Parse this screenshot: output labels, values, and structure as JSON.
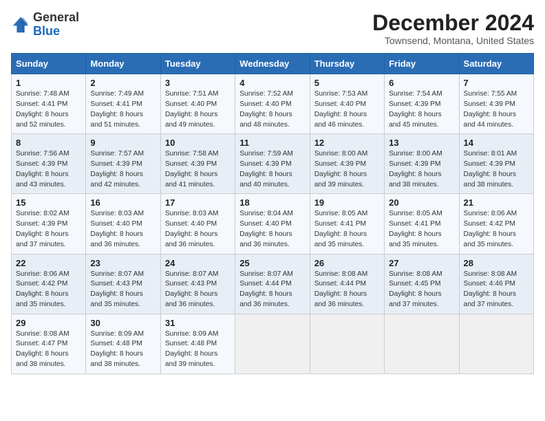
{
  "header": {
    "logo_general": "General",
    "logo_blue": "Blue",
    "title": "December 2024",
    "subtitle": "Townsend, Montana, United States"
  },
  "weekdays": [
    "Sunday",
    "Monday",
    "Tuesday",
    "Wednesday",
    "Thursday",
    "Friday",
    "Saturday"
  ],
  "weeks": [
    [
      {
        "day": "1",
        "rise": "Sunrise: 7:48 AM",
        "set": "Sunset: 4:41 PM",
        "light": "Daylight: 8 hours and 52 minutes."
      },
      {
        "day": "2",
        "rise": "Sunrise: 7:49 AM",
        "set": "Sunset: 4:41 PM",
        "light": "Daylight: 8 hours and 51 minutes."
      },
      {
        "day": "3",
        "rise": "Sunrise: 7:51 AM",
        "set": "Sunset: 4:40 PM",
        "light": "Daylight: 8 hours and 49 minutes."
      },
      {
        "day": "4",
        "rise": "Sunrise: 7:52 AM",
        "set": "Sunset: 4:40 PM",
        "light": "Daylight: 8 hours and 48 minutes."
      },
      {
        "day": "5",
        "rise": "Sunrise: 7:53 AM",
        "set": "Sunset: 4:40 PM",
        "light": "Daylight: 8 hours and 46 minutes."
      },
      {
        "day": "6",
        "rise": "Sunrise: 7:54 AM",
        "set": "Sunset: 4:39 PM",
        "light": "Daylight: 8 hours and 45 minutes."
      },
      {
        "day": "7",
        "rise": "Sunrise: 7:55 AM",
        "set": "Sunset: 4:39 PM",
        "light": "Daylight: 8 hours and 44 minutes."
      }
    ],
    [
      {
        "day": "8",
        "rise": "Sunrise: 7:56 AM",
        "set": "Sunset: 4:39 PM",
        "light": "Daylight: 8 hours and 43 minutes."
      },
      {
        "day": "9",
        "rise": "Sunrise: 7:57 AM",
        "set": "Sunset: 4:39 PM",
        "light": "Daylight: 8 hours and 42 minutes."
      },
      {
        "day": "10",
        "rise": "Sunrise: 7:58 AM",
        "set": "Sunset: 4:39 PM",
        "light": "Daylight: 8 hours and 41 minutes."
      },
      {
        "day": "11",
        "rise": "Sunrise: 7:59 AM",
        "set": "Sunset: 4:39 PM",
        "light": "Daylight: 8 hours and 40 minutes."
      },
      {
        "day": "12",
        "rise": "Sunrise: 8:00 AM",
        "set": "Sunset: 4:39 PM",
        "light": "Daylight: 8 hours and 39 minutes."
      },
      {
        "day": "13",
        "rise": "Sunrise: 8:00 AM",
        "set": "Sunset: 4:39 PM",
        "light": "Daylight: 8 hours and 38 minutes."
      },
      {
        "day": "14",
        "rise": "Sunrise: 8:01 AM",
        "set": "Sunset: 4:39 PM",
        "light": "Daylight: 8 hours and 38 minutes."
      }
    ],
    [
      {
        "day": "15",
        "rise": "Sunrise: 8:02 AM",
        "set": "Sunset: 4:39 PM",
        "light": "Daylight: 8 hours and 37 minutes."
      },
      {
        "day": "16",
        "rise": "Sunrise: 8:03 AM",
        "set": "Sunset: 4:40 PM",
        "light": "Daylight: 8 hours and 36 minutes."
      },
      {
        "day": "17",
        "rise": "Sunrise: 8:03 AM",
        "set": "Sunset: 4:40 PM",
        "light": "Daylight: 8 hours and 36 minutes."
      },
      {
        "day": "18",
        "rise": "Sunrise: 8:04 AM",
        "set": "Sunset: 4:40 PM",
        "light": "Daylight: 8 hours and 36 minutes."
      },
      {
        "day": "19",
        "rise": "Sunrise: 8:05 AM",
        "set": "Sunset: 4:41 PM",
        "light": "Daylight: 8 hours and 35 minutes."
      },
      {
        "day": "20",
        "rise": "Sunrise: 8:05 AM",
        "set": "Sunset: 4:41 PM",
        "light": "Daylight: 8 hours and 35 minutes."
      },
      {
        "day": "21",
        "rise": "Sunrise: 8:06 AM",
        "set": "Sunset: 4:42 PM",
        "light": "Daylight: 8 hours and 35 minutes."
      }
    ],
    [
      {
        "day": "22",
        "rise": "Sunrise: 8:06 AM",
        "set": "Sunset: 4:42 PM",
        "light": "Daylight: 8 hours and 35 minutes."
      },
      {
        "day": "23",
        "rise": "Sunrise: 8:07 AM",
        "set": "Sunset: 4:43 PM",
        "light": "Daylight: 8 hours and 35 minutes."
      },
      {
        "day": "24",
        "rise": "Sunrise: 8:07 AM",
        "set": "Sunset: 4:43 PM",
        "light": "Daylight: 8 hours and 36 minutes."
      },
      {
        "day": "25",
        "rise": "Sunrise: 8:07 AM",
        "set": "Sunset: 4:44 PM",
        "light": "Daylight: 8 hours and 36 minutes."
      },
      {
        "day": "26",
        "rise": "Sunrise: 8:08 AM",
        "set": "Sunset: 4:44 PM",
        "light": "Daylight: 8 hours and 36 minutes."
      },
      {
        "day": "27",
        "rise": "Sunrise: 8:08 AM",
        "set": "Sunset: 4:45 PM",
        "light": "Daylight: 8 hours and 37 minutes."
      },
      {
        "day": "28",
        "rise": "Sunrise: 8:08 AM",
        "set": "Sunset: 4:46 PM",
        "light": "Daylight: 8 hours and 37 minutes."
      }
    ],
    [
      {
        "day": "29",
        "rise": "Sunrise: 8:08 AM",
        "set": "Sunset: 4:47 PM",
        "light": "Daylight: 8 hours and 38 minutes."
      },
      {
        "day": "30",
        "rise": "Sunrise: 8:09 AM",
        "set": "Sunset: 4:48 PM",
        "light": "Daylight: 8 hours and 38 minutes."
      },
      {
        "day": "31",
        "rise": "Sunrise: 8:09 AM",
        "set": "Sunset: 4:48 PM",
        "light": "Daylight: 8 hours and 39 minutes."
      },
      null,
      null,
      null,
      null
    ]
  ]
}
